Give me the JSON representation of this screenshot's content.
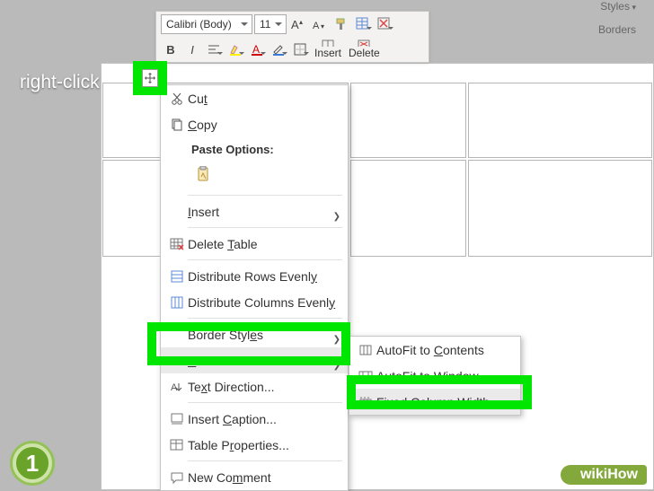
{
  "header": {
    "styles_label": "Styles",
    "borders_label": "Borders"
  },
  "toolbar": {
    "font_name": "Calibri (Body)",
    "font_size": "11",
    "insert_label": "Insert",
    "delete_label": "Delete"
  },
  "callouts": {
    "right_click": "right-click",
    "step": "1",
    "watermark": "wikiHow"
  },
  "menu": {
    "cut": "Cut",
    "copy": "Copy",
    "paste_options": "Paste Options:",
    "insert": "Insert",
    "delete_table": "Delete Table",
    "distribute_rows": "Distribute Rows Evenly",
    "distribute_cols": "Distribute Columns Evenly",
    "border_styles": "Border Styles",
    "autofit": "AutoFit",
    "text_direction": "Text Direction...",
    "insert_caption": "Insert Caption...",
    "table_properties": "Table Properties...",
    "new_comment": "New Comment"
  },
  "submenu": {
    "contents": "AutoFit to Contents",
    "window": "AutoFit to Window",
    "fixed": "Fixed Column Width"
  }
}
